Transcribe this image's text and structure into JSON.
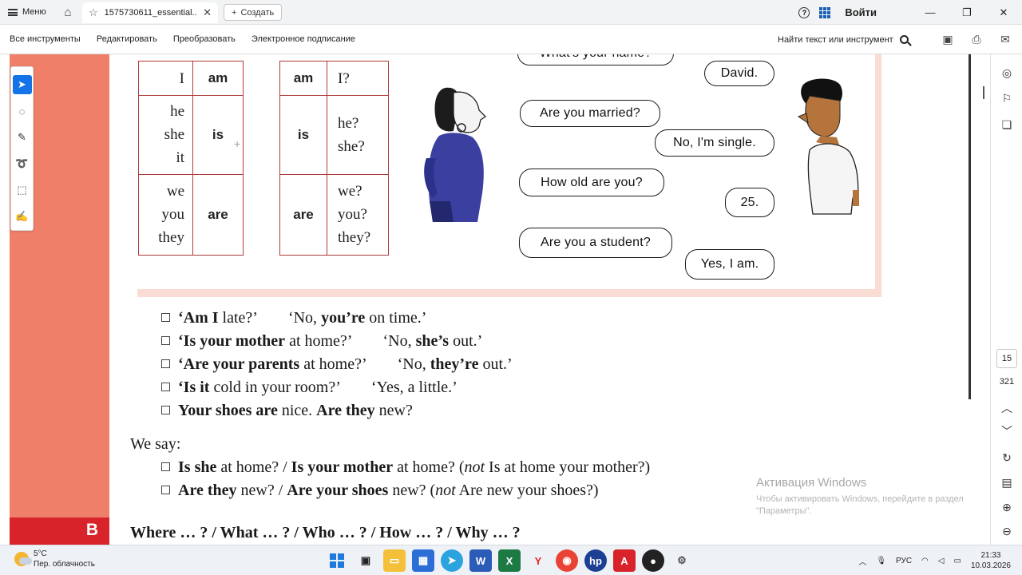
{
  "browser": {
    "menu_label": "Меню",
    "tab_title": "1575730611_essential...",
    "new_tab_label": "Создать",
    "login_label": "Войти",
    "window_controls": [
      "minimize-icon",
      "restore-icon",
      "close-icon"
    ]
  },
  "toolbar": {
    "all_tools": "Все инструменты",
    "edit": "Редактировать",
    "convert": "Преобразовать",
    "esign": "Электронное подписание",
    "find_label": "Найти текст или инструмент"
  },
  "tables": {
    "affirmative": [
      {
        "pronouns": [
          "I"
        ],
        "verb": "am"
      },
      {
        "pronouns": [
          "he",
          "she",
          "it"
        ],
        "verb": "is"
      },
      {
        "pronouns": [
          "we",
          "you",
          "they"
        ],
        "verb": "are"
      }
    ],
    "question": [
      {
        "verb": "am",
        "pronouns": [
          "I?"
        ]
      },
      {
        "verb": "is",
        "pronouns": [
          "he?",
          "she?"
        ]
      },
      {
        "verb": "are",
        "pronouns": [
          "we?",
          "you?",
          "they?"
        ]
      }
    ]
  },
  "dialogue": {
    "top_cut": "What's your name?",
    "david": "David.",
    "married": "Are you married?",
    "single": "No, I'm single.",
    "old": "How old are you?",
    "age": "25.",
    "student": "Are you a student?",
    "yes": "Yes, I am."
  },
  "examples": {
    "e1_a_bold": "‘Am I",
    "e1_a": " late?’",
    "e1_b1": "‘No, ",
    "e1_b_bold": "you’re",
    "e1_b2": " on time.’",
    "e2_a_bold": "‘Is your mother",
    "e2_a": " at home?’",
    "e2_b1": "‘No, ",
    "e2_b_bold": "she’s",
    "e2_b2": " out.’",
    "e3_a_bold": "‘Are your parents",
    "e3_a": " at home?’",
    "e3_b1": "‘No, ",
    "e3_b_bold": "they’re",
    "e3_b2": " out.’",
    "e4_a_bold": "‘Is it",
    "e4_a": " cold in your room?’",
    "e4_b": "‘Yes, a little.’",
    "e5_bold1": "Your shoes are",
    "e5_mid": " nice.  ",
    "e5_bold2": "Are they",
    "e5_end": " new?"
  },
  "we_say": {
    "label": "We say:",
    "l1_b1": "Is she",
    "l1_t1": " at home? / ",
    "l1_b2": "Is your mother",
    "l1_t2": " at home?  (",
    "l1_not": "not",
    "l1_t3": " Is at home your mother?)",
    "l2_b1": "Are they",
    "l2_t1": " new? / ",
    "l2_b2": "Are your shoes",
    "l2_t2": " new?  (",
    "l2_not": "not",
    "l2_t3": " Are new your shoes?)"
  },
  "section_b": {
    "letter": "B",
    "heading": "Where … ? / What … ? / Who … ? / How … ? / Why … ?"
  },
  "viewer": {
    "current_page": "15",
    "total_pages": "321"
  },
  "watermark": {
    "title": "Активация Windows",
    "line1": "Чтобы активировать Windows, перейдите в раздел",
    "line2": "\"Параметры\"."
  },
  "taskbar": {
    "temp": "5°C",
    "weather": "Пер. облачность",
    "lang": "РУС",
    "time": "21:33",
    "date": "10.03.2026"
  },
  "colors": {
    "accent_blue": "#1473e6",
    "salmon": "#f07f6a",
    "section_red": "#d8232a",
    "table_border": "#b03a3a"
  }
}
